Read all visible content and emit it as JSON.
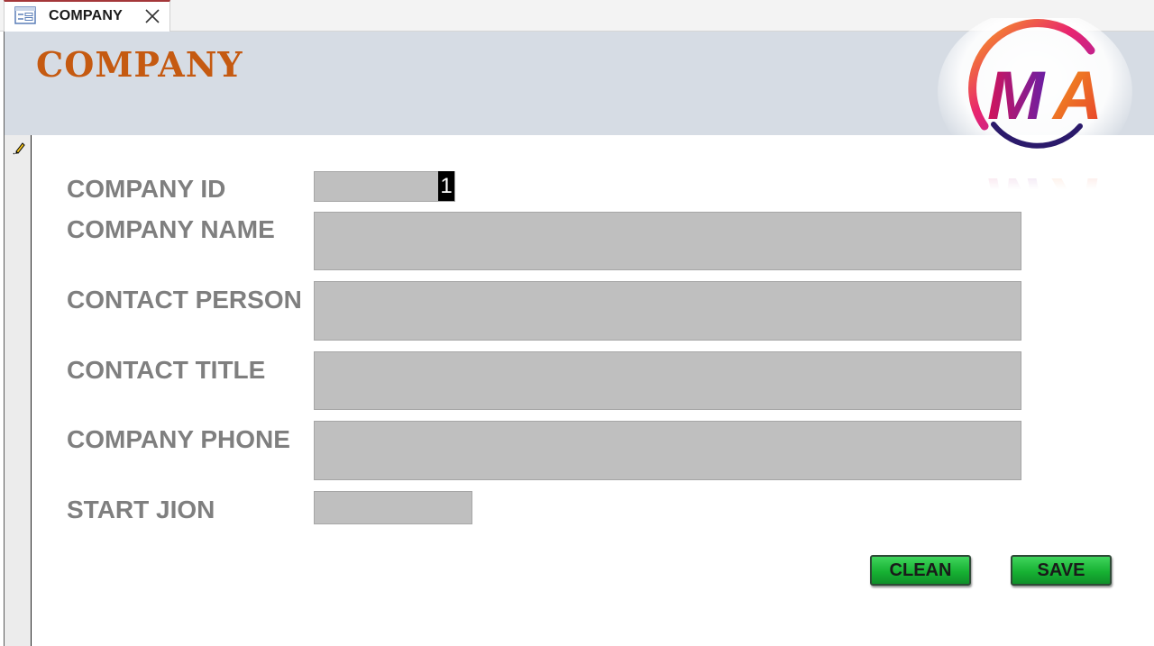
{
  "tab": {
    "title": "COMPANY",
    "icon": "form-icon",
    "close_icon": "close-icon"
  },
  "header": {
    "title": "COMPANY",
    "title_color": "#c55a11",
    "band_color": "#d6dce4",
    "logo_text": "MA"
  },
  "fields": [
    {
      "label": "COMPANY ID",
      "value": "1"
    },
    {
      "label": "COMPANY NAME",
      "value": ""
    },
    {
      "label": "CONTACT PERSON",
      "value": ""
    },
    {
      "label": "CONTACT TITLE",
      "value": ""
    },
    {
      "label": "COMPANY PHONE",
      "value": ""
    },
    {
      "label": "START JION",
      "value": ""
    }
  ],
  "buttons": {
    "clean": "CLEAN",
    "save": "SAVE",
    "color": "#17b233"
  },
  "record_selector_icon": "pencil-icon"
}
